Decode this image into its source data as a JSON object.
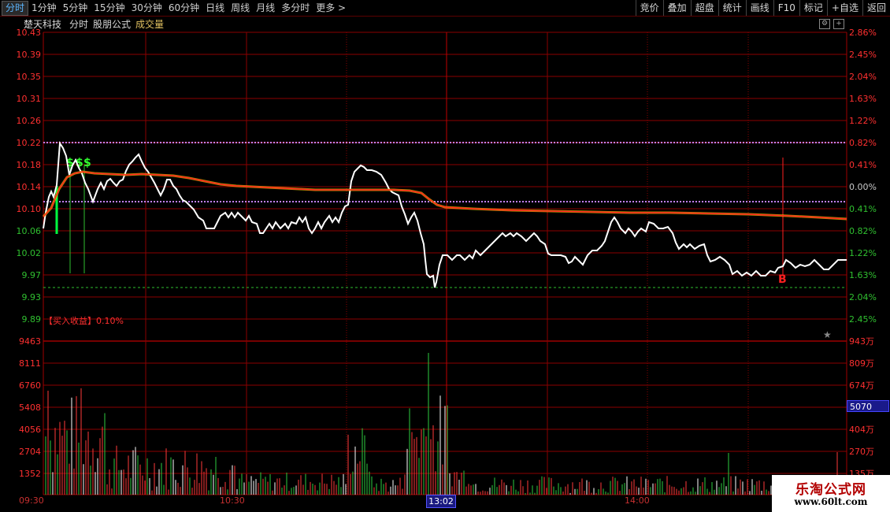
{
  "toolbar": {
    "periods": [
      "分时",
      "1分钟",
      "5分钟",
      "15分钟",
      "30分钟",
      "60分钟",
      "日线",
      "周线",
      "月线",
      "多分时",
      "更多 >"
    ],
    "active_period": "分时",
    "buttons": [
      "竞价",
      "叠加",
      "超盘",
      "统计",
      "画线",
      "F10",
      "标记",
      "+自选",
      "返回"
    ]
  },
  "info": {
    "stock_name": "楚天科技",
    "period": "分时",
    "formula": "股朋公式",
    "volume_label": "成交量"
  },
  "price_axis": {
    "left": [
      "10.43",
      "10.39",
      "10.35",
      "10.31",
      "10.26",
      "10.22",
      "10.18",
      "10.14",
      "10.10",
      "10.06",
      "10.02",
      "9.97",
      "9.93",
      "9.89"
    ],
    "right": [
      "2.86%",
      "2.45%",
      "2.04%",
      "1.63%",
      "1.22%",
      "0.82%",
      "0.41%",
      "0.00%",
      "0.41%",
      "0.82%",
      "1.22%",
      "1.63%",
      "2.04%",
      "2.45%"
    ]
  },
  "volume_axis": {
    "left": [
      "9463",
      "8111",
      "6760",
      "5408",
      "4056",
      "2704",
      "1352"
    ],
    "right": [
      "943万",
      "809万",
      "674万",
      "",
      "404万",
      "270万",
      "135万"
    ],
    "current_badge": "5070"
  },
  "time_axis": {
    "ticks": [
      "09:30",
      "10:30",
      "14:00"
    ],
    "active_time": "13:02"
  },
  "markers": {
    "dollar": "$",
    "dollar2": "$",
    "dollar3": "$",
    "buy": "B",
    "star": "★"
  },
  "buy_return": "【买入收益】0.10%",
  "watermark": {
    "title": "乐淘公式网",
    "url": "www.60lt.com"
  },
  "colors": {
    "price_line": "#ffffff",
    "avg_line": "#ff2020",
    "avg_line_glow": "#ffd000",
    "grid": "#8b0000",
    "up_bar": "#ff3a3a",
    "down_bar": "#2ecc40",
    "neutral_bar": "#ffffff",
    "axis_text_red": "#ff3030",
    "axis_text_green": "#30c030"
  }
}
